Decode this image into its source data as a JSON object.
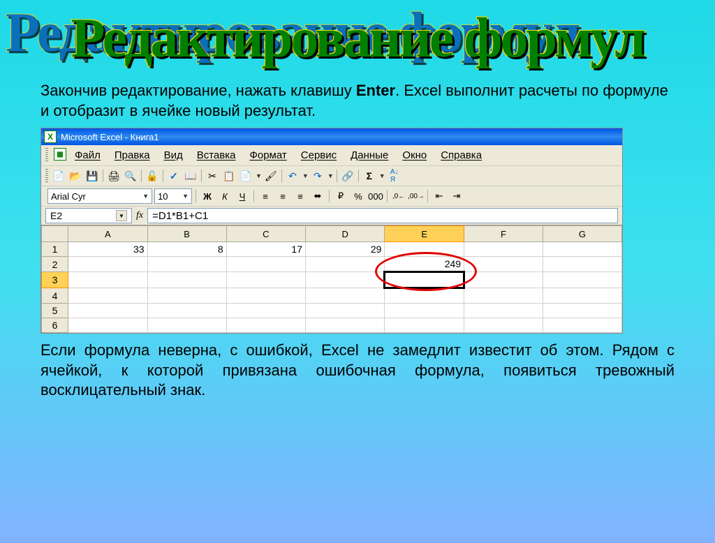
{
  "slide": {
    "title": "Редактирование формул",
    "desc_before": "Закончив редактирование, нажать клавишу ",
    "desc_key": "Enter",
    "desc_after": ". Excel выполнит расчеты по формуле и отобразит в ячейке новый результат.",
    "desc2": "Если формула неверна, с ошибкой, Excel не замедлит  известит об этом. Рядом с ячейкой, к которой привязана ошибочная формула, появиться тревожный восклицательный знак."
  },
  "excel": {
    "window_title": "Microsoft Excel - Книга1",
    "menu": [
      "Файл",
      "Правка",
      "Вид",
      "Вставка",
      "Формат",
      "Сервис",
      "Данные",
      "Окно",
      "Справка"
    ],
    "font_name": "Arial Cyr",
    "font_size": "10",
    "name_box": "E2",
    "formula": "=D1*B1+C1",
    "columns": [
      "A",
      "B",
      "C",
      "D",
      "E",
      "F",
      "G"
    ],
    "rows": [
      "1",
      "2",
      "3",
      "4",
      "5",
      "6"
    ],
    "data": {
      "A1": "33",
      "B1": "8",
      "C1": "17",
      "D1": "29",
      "E2": "249"
    },
    "selected_cell": "E3",
    "selected_col": "E",
    "selected_row": "3"
  }
}
